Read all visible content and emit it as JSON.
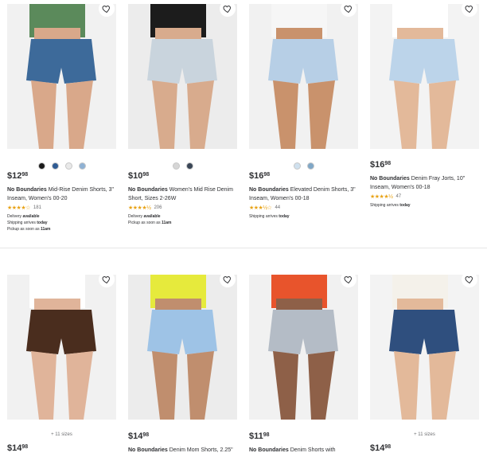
{
  "products": [
    {
      "price_dollars": "$12",
      "price_cents": "98",
      "brand": "No Boundaries",
      "name": "Mid-Rise Denim Shorts, 3\" Inseam, Women's 00-20",
      "rating_stars": "★★★★☆",
      "review_count": "181",
      "delivery_label": "Delivery",
      "delivery_value": "available",
      "shipping_label": "Shipping arrives",
      "shipping_value": "today",
      "pickup_label": "Pickup as soon as",
      "pickup_value": "11am",
      "swatches": [
        "#1a1a1a",
        "#2f5b93",
        "#e9e9e9",
        "#8fb2d4"
      ],
      "image": {
        "bg": "#f1f1f1",
        "shorts": "#3d6a9a",
        "top": "#5b8a5b",
        "skin": "#d9a88a"
      }
    },
    {
      "price_dollars": "$10",
      "price_cents": "98",
      "brand": "No Boundaries",
      "name": "Women's Mid Rise Denim Short, Sizes 2-26W",
      "rating_stars": "★★★★½",
      "review_count": "206",
      "delivery_label": "Delivery",
      "delivery_value": "available",
      "pickup_label": "Pickup as soon as",
      "pickup_value": "11am",
      "swatches": [
        "#d6d6d6",
        "#3a4656"
      ],
      "image": {
        "bg": "#ececec",
        "shorts": "#c9d4dd",
        "top": "#1c1c1c",
        "skin": "#d8ab8d"
      }
    },
    {
      "price_dollars": "$16",
      "price_cents": "98",
      "brand": "No Boundaries",
      "name": "Elevated Denim Shorts, 3\" Inseam, Women's 00-18",
      "rating_stars": "★★★½☆",
      "review_count": "44",
      "shipping_label": "Shipping arrives",
      "shipping_value": "today",
      "swatches": [
        "#cfe0ee",
        "#7fa7c7"
      ],
      "image": {
        "bg": "#f1f1f1",
        "shorts": "#b7cfe6",
        "top": "#f6f6f6",
        "skin": "#c9926c"
      }
    },
    {
      "price_dollars": "$16",
      "price_cents": "98",
      "brand": "No Boundaries",
      "name": "Denim Fray Jorts, 10\" Inseam, Women's 00-18",
      "rating_stars": "★★★★½",
      "review_count": "47",
      "shipping_label": "Shipping arrives",
      "shipping_value": "today",
      "image": {
        "bg": "#f3f3f3",
        "shorts": "#bcd4ea",
        "top": "#ffffff",
        "skin": "#e3b99a"
      }
    },
    {
      "price_dollars": "$14",
      "price_cents": "98",
      "sizes_text": "+ 11 sizes",
      "image": {
        "bg": "#f1f1f1",
        "shorts": "#4a2d1e",
        "top": "#ffffff",
        "skin": "#e0b49a"
      }
    },
    {
      "price_dollars": "$14",
      "price_cents": "98",
      "brand": "No Boundaries",
      "name": "Denim Mom Shorts, 2.25\"",
      "image": {
        "bg": "#ececec",
        "shorts": "#9ec3e6",
        "top": "#e6ea3c",
        "skin": "#c08e6e"
      }
    },
    {
      "price_dollars": "$11",
      "price_cents": "98",
      "brand": "No Boundaries",
      "name": "Denim Shorts with",
      "image": {
        "bg": "#f1f1f1",
        "shorts": "#b4bcc6",
        "top": "#e8542c",
        "skin": "#8e6048"
      }
    },
    {
      "price_dollars": "$14",
      "price_cents": "98",
      "sizes_text": "+ 11 sizes",
      "image": {
        "bg": "#f3f3f3",
        "shorts": "#2f4f7e",
        "top": "#f4f1ea",
        "skin": "#e3b99a"
      }
    }
  ],
  "icons": {
    "favorite": "heart-icon"
  }
}
